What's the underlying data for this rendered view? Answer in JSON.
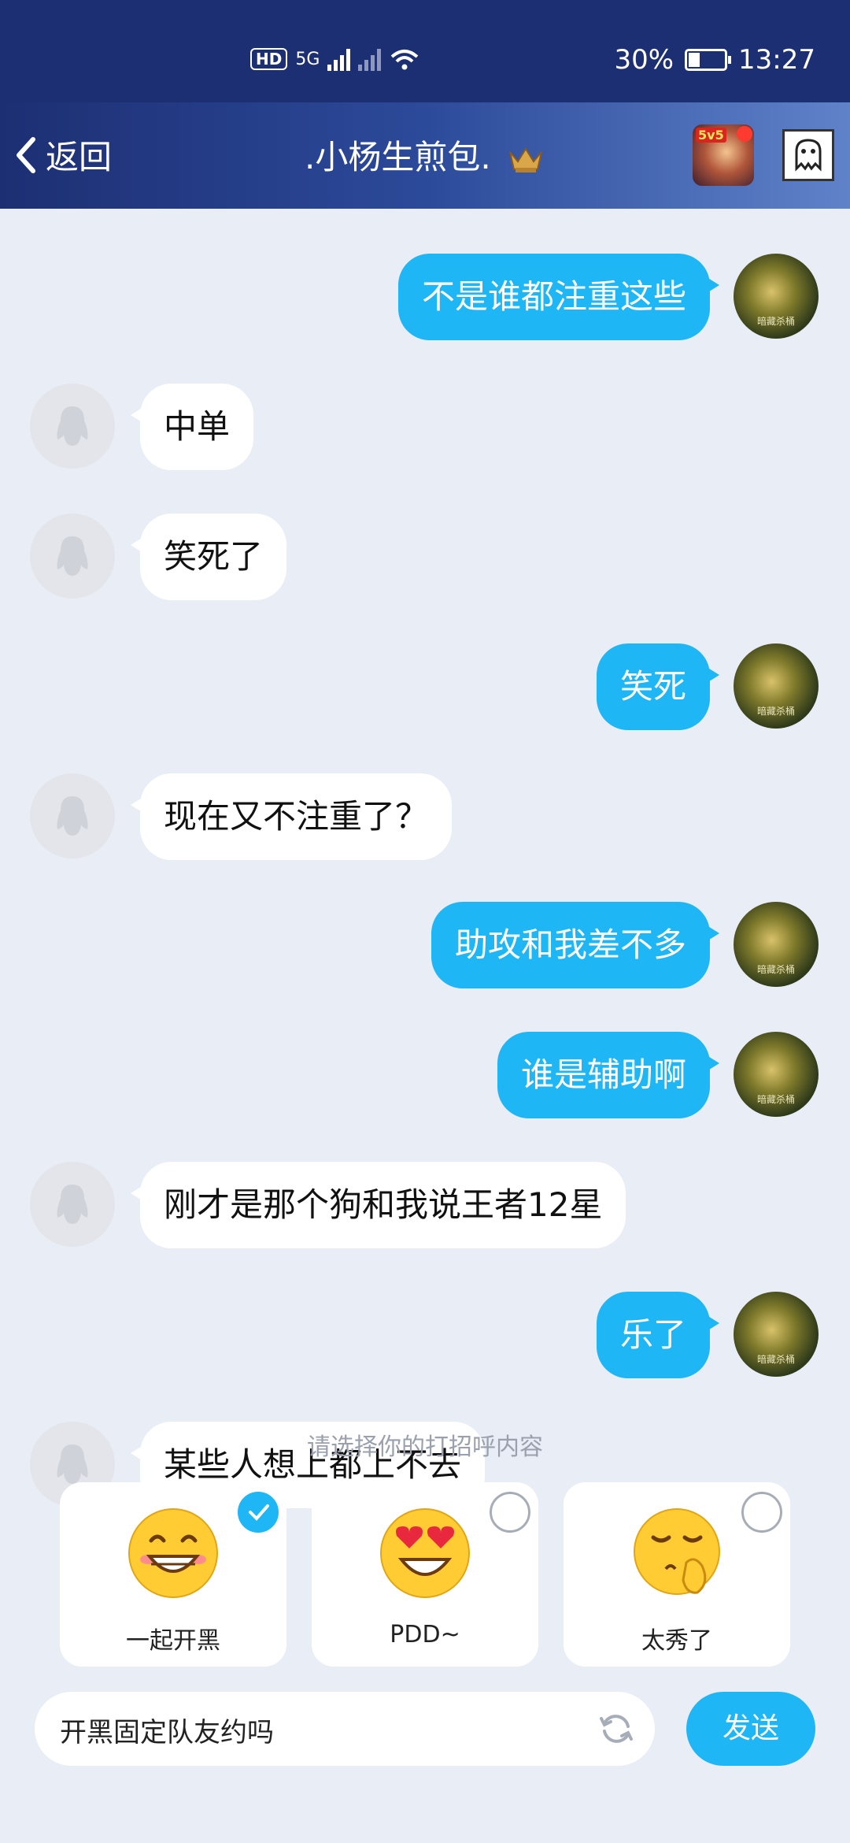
{
  "status_bar": {
    "hd": "HD",
    "network": "5G",
    "battery_percent_text": "30%",
    "battery_level": 0.3,
    "time": "13:27"
  },
  "header": {
    "back_label": "返回",
    "title": ".小杨生煎包.",
    "game_badge": "5v5"
  },
  "messages": [
    {
      "side": "me",
      "text": "不是谁都注重这些"
    },
    {
      "side": "them",
      "text": "中单"
    },
    {
      "side": "them",
      "text": "笑死了"
    },
    {
      "side": "me",
      "text": "笑死"
    },
    {
      "side": "them",
      "text": "现在又不注重了？"
    },
    {
      "side": "me",
      "text": "助攻和我差不多"
    },
    {
      "side": "me",
      "text": "谁是辅助啊"
    },
    {
      "side": "them",
      "text": "刚才是那个狗和我说王者12星"
    },
    {
      "side": "me",
      "text": "乐了"
    },
    {
      "side": "them",
      "text": "某些人想上都上不去"
    }
  ],
  "avatar_caption": "暗藏杀桶",
  "greeting_panel": {
    "hint": "请选择你的打招呼内容",
    "options": [
      {
        "label": "一起开黑",
        "icon": "grin-emoji-icon",
        "selected": true
      },
      {
        "label": "PDD~",
        "icon": "heart-eyes-emoji-icon",
        "selected": false
      },
      {
        "label": "太秀了",
        "icon": "applause-emoji-icon",
        "selected": false
      }
    ]
  },
  "composer": {
    "text": "开黑固定队友约吗",
    "send_label": "发送"
  },
  "colors": {
    "header_dark": "#1d2f73",
    "bubble_me": "#1eb6f5",
    "bubble_them": "#ffffff",
    "background": "#e9edf5"
  }
}
